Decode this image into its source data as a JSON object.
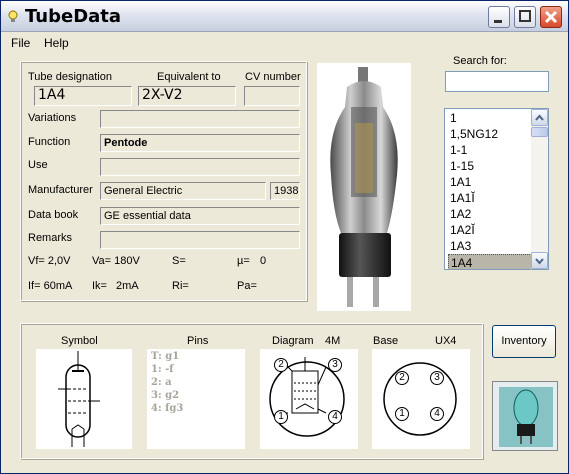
{
  "window": {
    "title": "TubeData"
  },
  "menu": {
    "file": "File",
    "help": "Help"
  },
  "labels": {
    "tube_designation": "Tube designation",
    "equivalent_to": "Equivalent to",
    "cv_number": "CV number",
    "variations": "Variations",
    "function": "Function",
    "use": "Use",
    "manufacturer": "Manufacturer",
    "data_book": "Data book",
    "remarks": "Remarks",
    "search_for": "Search for:",
    "symbol": "Symbol",
    "pins": "Pins",
    "diagram": "Diagram",
    "base": "Base"
  },
  "tube": {
    "designation": "1A4",
    "equivalent": "2X-V2",
    "cv_number": "",
    "variations": "",
    "function": "Pentode",
    "use": "",
    "manufacturer": "General Electric",
    "year": "1938",
    "data_book": "GE essential data",
    "remarks": ""
  },
  "params": {
    "vf": "Vf= 2,0V",
    "va": "Va= 180V",
    "s": "S=",
    "mu": "µ=",
    "mu_value": "0",
    "if": "If= 60mA",
    "ik": "Ik=",
    "ik_value": "2mA",
    "ri": "Ri=",
    "pa": "Pa="
  },
  "search": {
    "value": ""
  },
  "tube_list": [
    "1",
    "1,5NG12",
    "1-1",
    "1-15",
    "1A1",
    "1A1Ĭ",
    "1A2",
    "1A2Ĭ",
    "1A3",
    "1A4"
  ],
  "selected_tube": "1A4",
  "pins": [
    "T: g1",
    "1: -f",
    "2: a",
    "3: g2",
    "4: fg3"
  ],
  "diagram_code": "4M",
  "base_type": "UX4",
  "diagram_pins": [
    "2",
    "3",
    "1",
    "4"
  ],
  "base_pins": [
    "2",
    "3",
    "1",
    "4"
  ],
  "buttons": {
    "inventory": "Inventory"
  },
  "icons": {
    "app": "lightbulb-icon",
    "minimize": "minimize-icon",
    "maximize": "maximize-icon",
    "close": "close-icon"
  }
}
